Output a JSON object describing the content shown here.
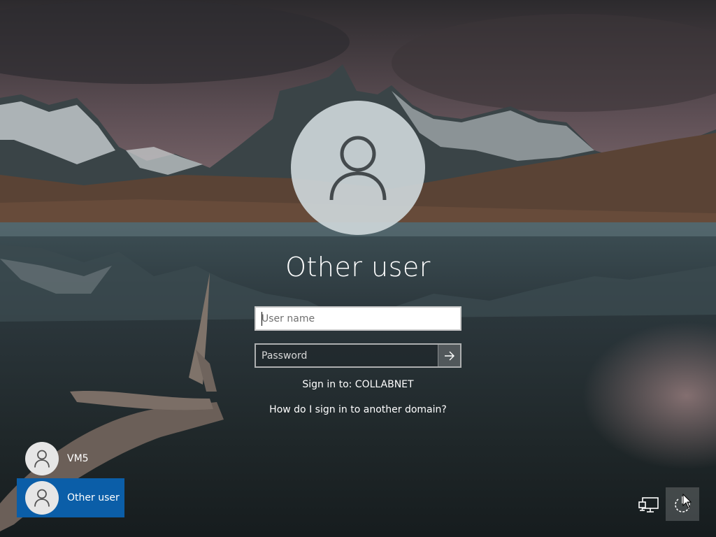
{
  "lock_screen": {
    "background": "mountain-lake-wallpaper",
    "accent_color": "#0b5ea8",
    "selected_user": {
      "name": "Other user",
      "avatar_icon": "user-icon"
    },
    "login_form": {
      "username_placeholder": "User name",
      "username_value": "",
      "password_placeholder": "Password",
      "password_value": "",
      "submit_icon": "arrow-right-icon"
    },
    "sign_in_to": "Sign in to: COLLABNET",
    "domain_help_link": "How do I sign in to another domain?"
  },
  "user_list": [
    {
      "label": "VM5",
      "icon": "user-icon",
      "selected": false
    },
    {
      "label": "Other user",
      "icon": "user-icon",
      "selected": true
    }
  ],
  "corner_buttons": [
    {
      "icon": "network-icon"
    },
    {
      "icon": "power-icon"
    }
  ]
}
